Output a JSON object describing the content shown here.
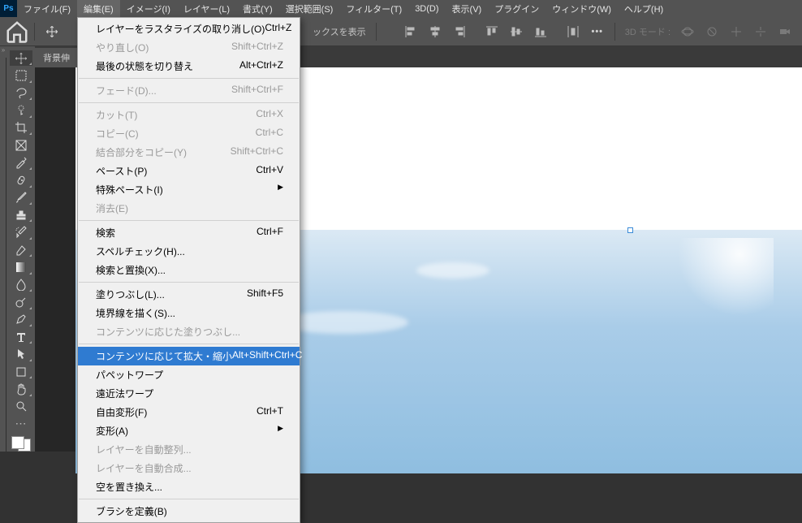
{
  "menubar": {
    "items": [
      "ファイル(F)",
      "編集(E)",
      "イメージ(I)",
      "レイヤー(L)",
      "書式(Y)",
      "選択範囲(S)",
      "フィルター(T)",
      "3D(D)",
      "表示(V)",
      "プラグイン",
      "ウィンドウ(W)",
      "ヘルプ(H)"
    ]
  },
  "options": {
    "transform_controls": "ックスを表示",
    "mode_label": "3D モード :"
  },
  "tab": {
    "label": "背景伸"
  },
  "edit_menu": [
    {
      "type": "item",
      "label": "レイヤーをラスタライズの取り消し(O)",
      "shortcut": "Ctrl+Z",
      "enabled": true
    },
    {
      "type": "item",
      "label": "やり直し(O)",
      "shortcut": "Shift+Ctrl+Z",
      "enabled": false
    },
    {
      "type": "item",
      "label": "最後の状態を切り替え",
      "shortcut": "Alt+Ctrl+Z",
      "enabled": true
    },
    {
      "type": "sep"
    },
    {
      "type": "item",
      "label": "フェード(D)...",
      "shortcut": "Shift+Ctrl+F",
      "enabled": false
    },
    {
      "type": "sep"
    },
    {
      "type": "item",
      "label": "カット(T)",
      "shortcut": "Ctrl+X",
      "enabled": false
    },
    {
      "type": "item",
      "label": "コピー(C)",
      "shortcut": "Ctrl+C",
      "enabled": false
    },
    {
      "type": "item",
      "label": "結合部分をコピー(Y)",
      "shortcut": "Shift+Ctrl+C",
      "enabled": false
    },
    {
      "type": "item",
      "label": "ペースト(P)",
      "shortcut": "Ctrl+V",
      "enabled": true
    },
    {
      "type": "submenu",
      "label": "特殊ペースト(I)",
      "enabled": true
    },
    {
      "type": "item",
      "label": "消去(E)",
      "shortcut": "",
      "enabled": false
    },
    {
      "type": "sep"
    },
    {
      "type": "item",
      "label": "検索",
      "shortcut": "Ctrl+F",
      "enabled": true
    },
    {
      "type": "item",
      "label": "スペルチェック(H)...",
      "shortcut": "",
      "enabled": true
    },
    {
      "type": "item",
      "label": "検索と置換(X)...",
      "shortcut": "",
      "enabled": true
    },
    {
      "type": "sep"
    },
    {
      "type": "item",
      "label": "塗りつぶし(L)...",
      "shortcut": "Shift+F5",
      "enabled": true
    },
    {
      "type": "item",
      "label": "境界線を描く(S)...",
      "shortcut": "",
      "enabled": true
    },
    {
      "type": "item",
      "label": "コンテンツに応じた塗りつぶし...",
      "shortcut": "",
      "enabled": false
    },
    {
      "type": "sep"
    },
    {
      "type": "item",
      "label": "コンテンツに応じて拡大・縮小",
      "shortcut": "Alt+Shift+Ctrl+C",
      "enabled": true,
      "highlight": true
    },
    {
      "type": "item",
      "label": "パペットワープ",
      "shortcut": "",
      "enabled": true
    },
    {
      "type": "item",
      "label": "遠近法ワープ",
      "shortcut": "",
      "enabled": true
    },
    {
      "type": "item",
      "label": "自由変形(F)",
      "shortcut": "Ctrl+T",
      "enabled": true
    },
    {
      "type": "submenu",
      "label": "変形(A)",
      "enabled": true
    },
    {
      "type": "item",
      "label": "レイヤーを自動整列...",
      "shortcut": "",
      "enabled": false
    },
    {
      "type": "item",
      "label": "レイヤーを自動合成...",
      "shortcut": "",
      "enabled": false
    },
    {
      "type": "item",
      "label": "空を置き換え...",
      "shortcut": "",
      "enabled": true
    },
    {
      "type": "sep"
    },
    {
      "type": "item",
      "label": "ブラシを定義(B)",
      "shortcut": "",
      "enabled": true
    }
  ]
}
